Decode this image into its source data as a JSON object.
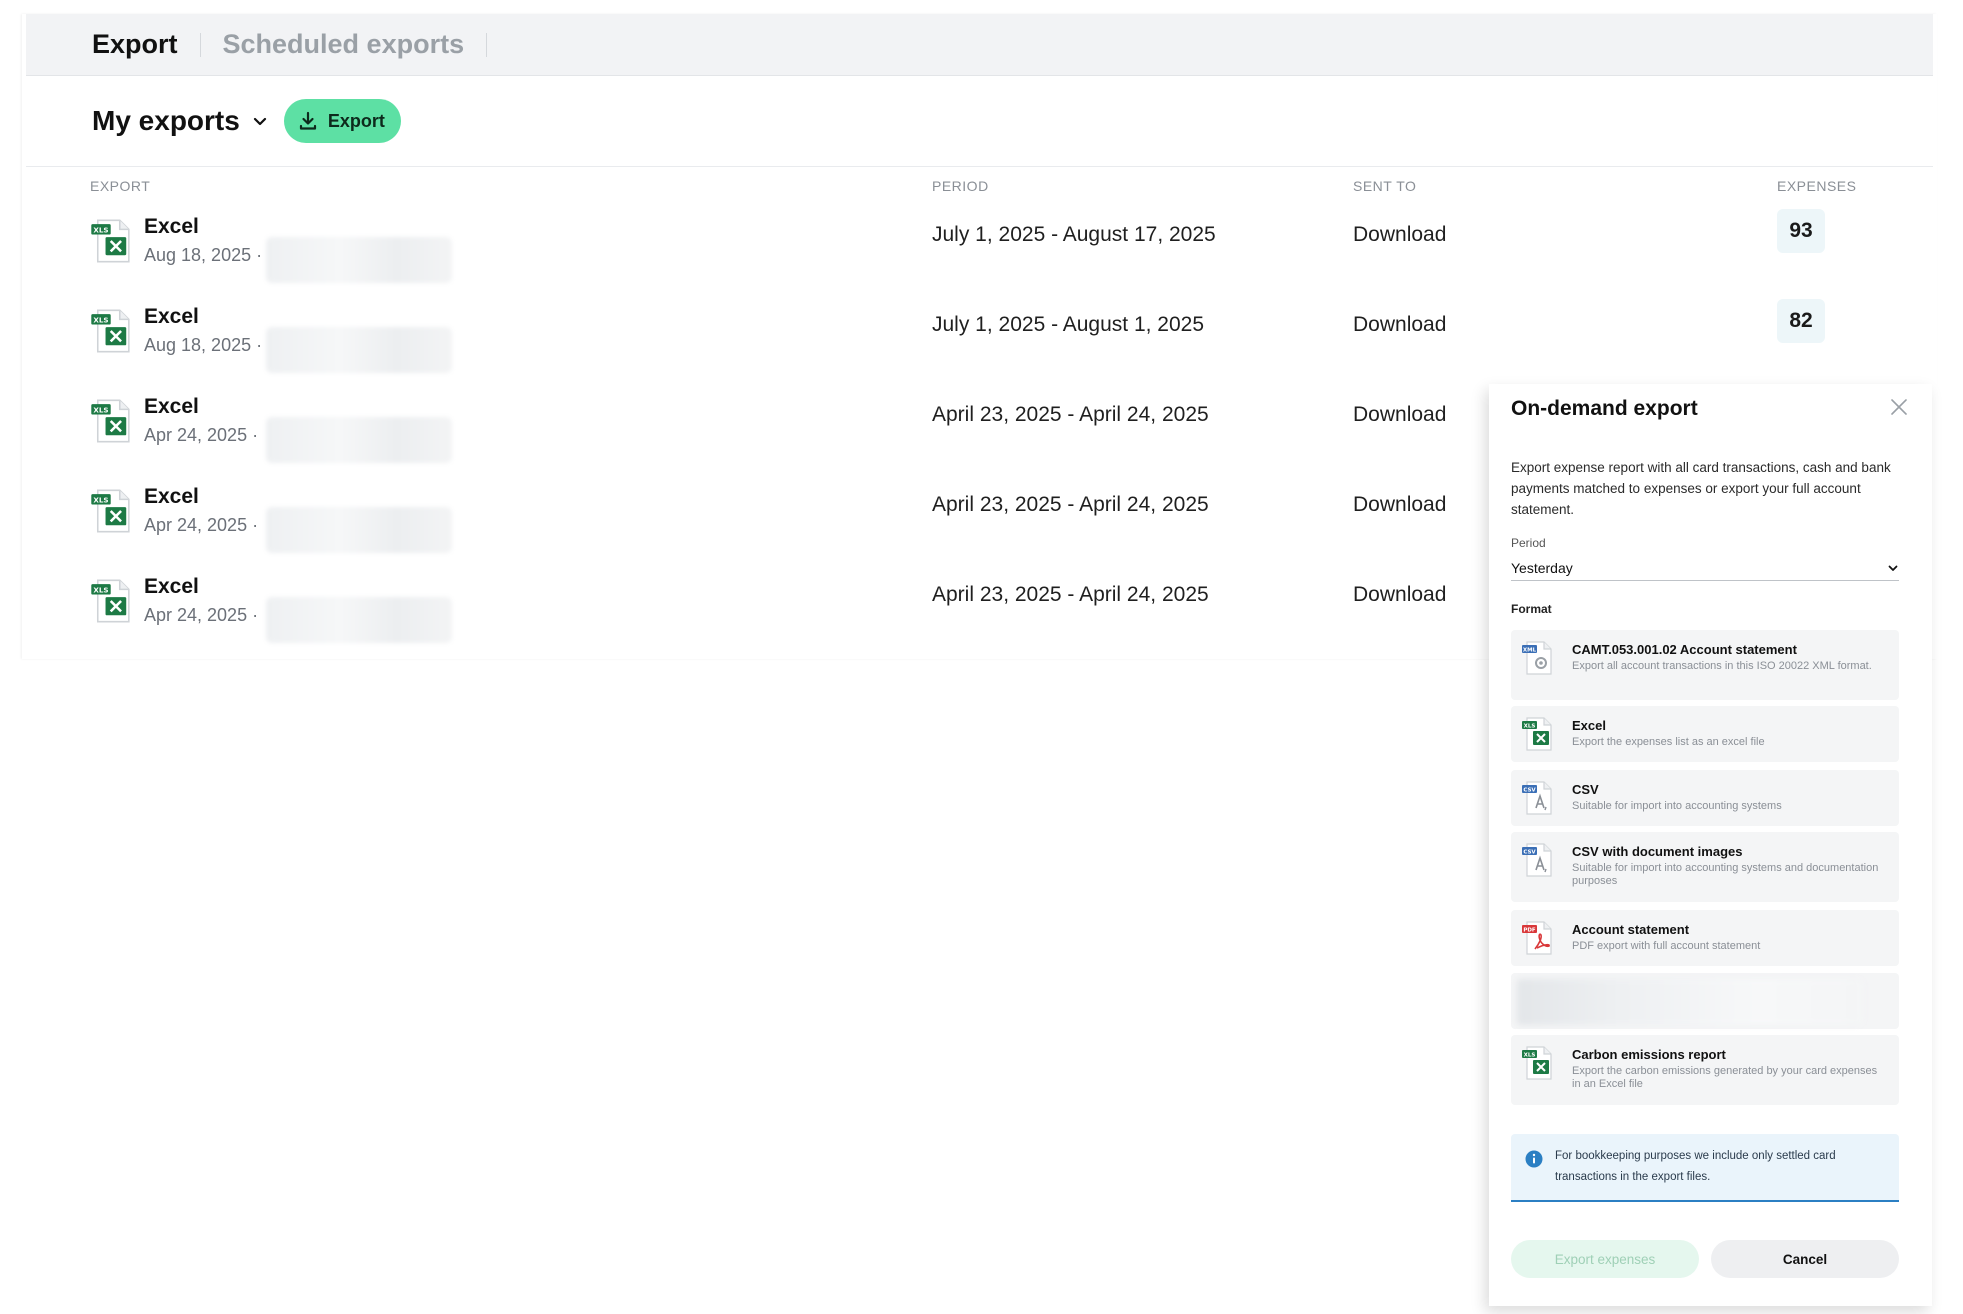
{
  "tabs": [
    {
      "label": "Export",
      "active": true
    },
    {
      "label": "Scheduled exports",
      "active": false
    }
  ],
  "header": {
    "title": "My exports",
    "export_button": "Export"
  },
  "table": {
    "columns": {
      "export": "EXPORT",
      "period": "PERIOD",
      "sent_to": "SENT TO",
      "expenses": "EXPENSES"
    },
    "rows": [
      {
        "name": "Excel",
        "date": "Aug 18, 2025 ·",
        "period": "July 1, 2025 - August 17, 2025",
        "sent_to": "Download",
        "expenses": "93"
      },
      {
        "name": "Excel",
        "date": "Aug 18, 2025 ·",
        "period": "July 1, 2025 - August 1, 2025",
        "sent_to": "Download",
        "expenses": "82"
      },
      {
        "name": "Excel",
        "date": "Apr 24, 2025 ·",
        "period": "April 23, 2025 - April 24, 2025",
        "sent_to": "Download",
        "expenses": ""
      },
      {
        "name": "Excel",
        "date": "Apr 24, 2025 ·",
        "period": "April 23, 2025 - April 24, 2025",
        "sent_to": "Download",
        "expenses": ""
      },
      {
        "name": "Excel",
        "date": "Apr 24, 2025 ·",
        "period": "April 23, 2025 - April 24, 2025",
        "sent_to": "Download",
        "expenses": ""
      }
    ]
  },
  "panel": {
    "title": "On-demand export",
    "description": "Export expense report with all card transactions, cash and bank payments matched to expenses or export your full account statement.",
    "period_label": "Period",
    "period_value": "Yesterday",
    "format_label": "Format",
    "options": [
      {
        "title": "CAMT.053.001.02 Account statement",
        "desc": "Export all account transactions in this ISO 20022 XML format.",
        "icon": "xml-file-icon"
      },
      {
        "title": "Excel",
        "desc": "Export the expenses list as an excel file",
        "icon": "excel-file-icon"
      },
      {
        "title": "CSV",
        "desc": "Suitable for import into accounting systems",
        "icon": "csv-file-icon"
      },
      {
        "title": "CSV with document images",
        "desc": "Suitable for import into accounting systems and documentation purposes",
        "icon": "csv-file-icon"
      },
      {
        "title": "Account statement",
        "desc": "PDF export with full account statement",
        "icon": "pdf-file-icon"
      },
      {
        "title": "",
        "desc": "",
        "icon": "blurred"
      },
      {
        "title": "Carbon emissions report",
        "desc": "Export the carbon emissions generated by your card expenses in an Excel file",
        "icon": "excel-file-icon"
      }
    ],
    "info_text": "For bookkeeping purposes we include only settled card transactions in the export files.",
    "primary_button": "Export expenses",
    "cancel_button": "Cancel"
  },
  "colors": {
    "accent_green": "#5de0a4",
    "info_blue": "#2b7fc3",
    "excel_green": "#1d7a45",
    "pdf_red": "#d9383a",
    "csv_blue": "#3b6fb6"
  }
}
